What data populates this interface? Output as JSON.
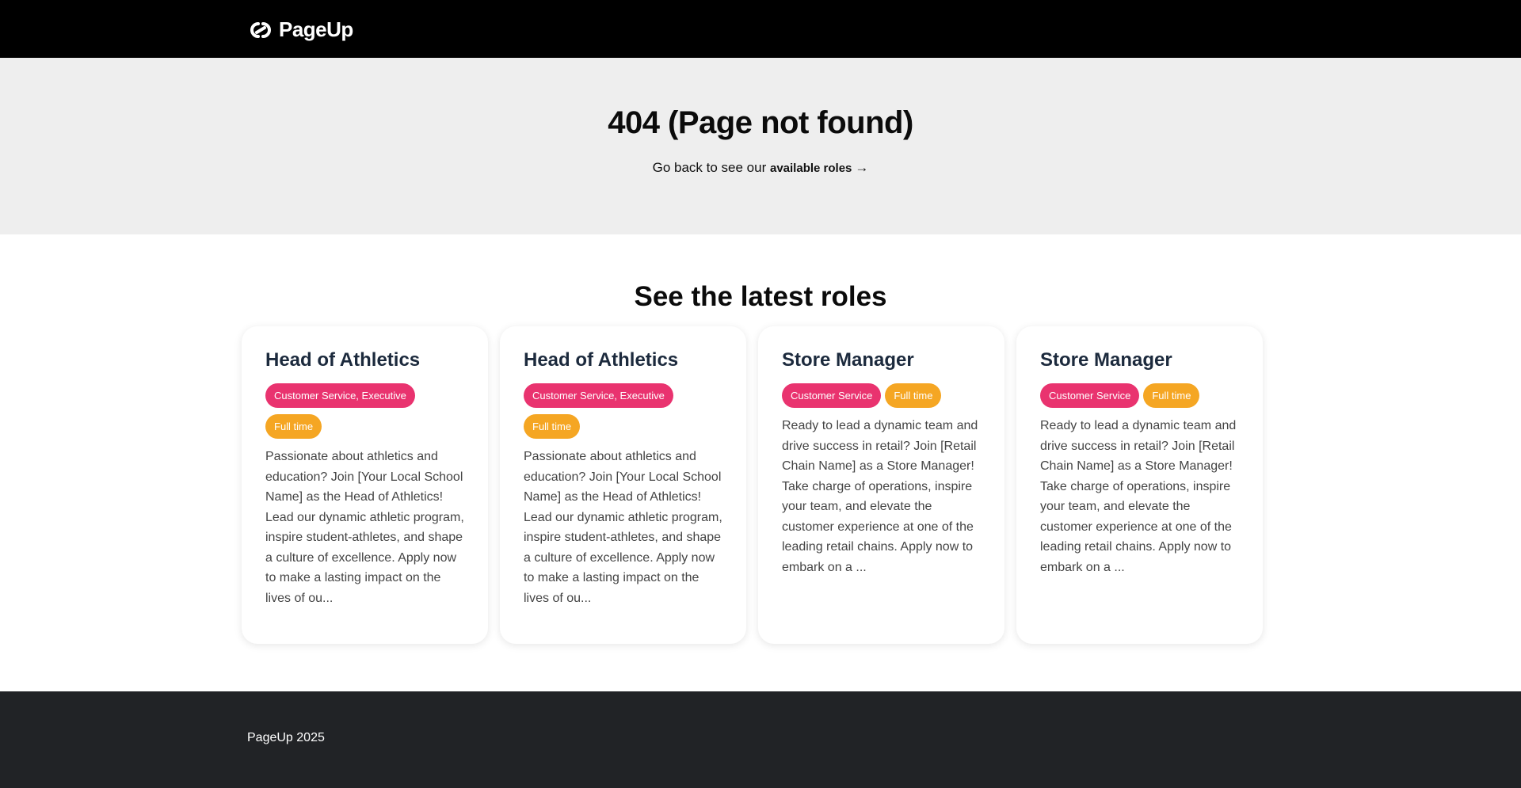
{
  "header": {
    "logo_text": "PageUp",
    "logo_icon": "pageup-logo-icon"
  },
  "hero": {
    "title": "404 (Page not found)",
    "subtitle_prefix": "Go back to see our",
    "link_label": "available roles",
    "arrow": "→"
  },
  "roles": {
    "title": "See the latest roles",
    "cards": [
      {
        "title": "Head of Athletics",
        "category": "Customer Service, Executive",
        "type": "Full time",
        "description": "Passionate about athletics and education? Join [Your Local School Name] as the Head of Athletics! Lead our dynamic athletic program, inspire student-athletes, and shape a culture of excellence. Apply now to make a lasting impact on the lives of ou..."
      },
      {
        "title": "Head of Athletics",
        "category": "Customer Service, Executive",
        "type": "Full time",
        "description": "Passionate about athletics and education? Join [Your Local School Name] as the Head of Athletics! Lead our dynamic athletic program, inspire student-athletes, and shape a culture of excellence. Apply now to make a lasting impact on the lives of ou..."
      },
      {
        "title": "Store Manager",
        "category": "Customer Service",
        "type": "Full time",
        "description": "Ready to lead a dynamic team and drive success in retail? Join [Retail Chain Name] as a Store Manager! Take charge of operations, inspire your team, and elevate the customer experience at one of the leading retail chains. Apply now to embark on a ..."
      },
      {
        "title": "Store Manager",
        "category": "Customer Service",
        "type": "Full time",
        "description": "Ready to lead a dynamic team and drive success in retail? Join [Retail Chain Name] as a Store Manager! Take charge of operations, inspire your team, and elevate the customer experience at one of the leading retail chains. Apply now to embark on a ..."
      }
    ]
  },
  "footer": {
    "text": "PageUp 2025"
  },
  "colors": {
    "header_bg": "#000000",
    "hero_bg": "#eeeeee",
    "footer_bg": "#212326",
    "category_tag": "#e9336f",
    "type_tag": "#f5a623",
    "card_title": "#1c2a3d"
  }
}
